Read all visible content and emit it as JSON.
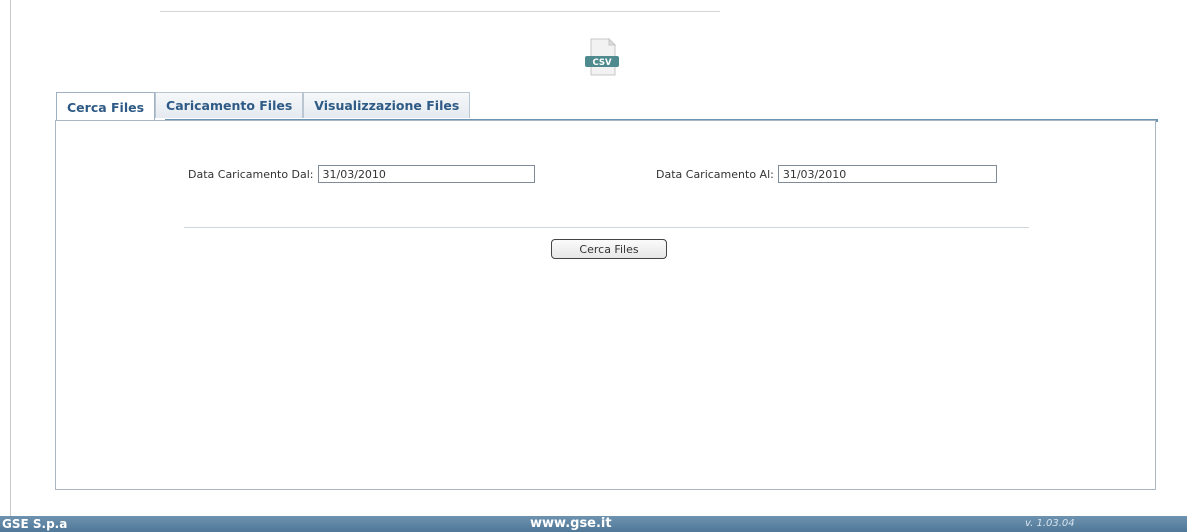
{
  "header": {
    "icon": "csv-file-icon",
    "icon_label": "CSV"
  },
  "tabs": [
    {
      "label": "Cerca Files",
      "active": true
    },
    {
      "label": "Caricamento Files",
      "active": false
    },
    {
      "label": "Visualizzazione Files",
      "active": false
    }
  ],
  "search_form": {
    "date_from_label": "Data Caricamento Dal:",
    "date_from_value": "31/03/2010",
    "date_to_label": "Data Caricamento Al:",
    "date_to_value": "31/03/2010",
    "search_button_label": "Cerca Files"
  },
  "footer": {
    "company": "GSE S.p.a",
    "website": "www.gse.it",
    "version": "v. 1.03.04"
  },
  "colors": {
    "accent": "#2e5a85",
    "footer_bar": "#5a82a2",
    "tab_strip": "#6b93b2"
  }
}
